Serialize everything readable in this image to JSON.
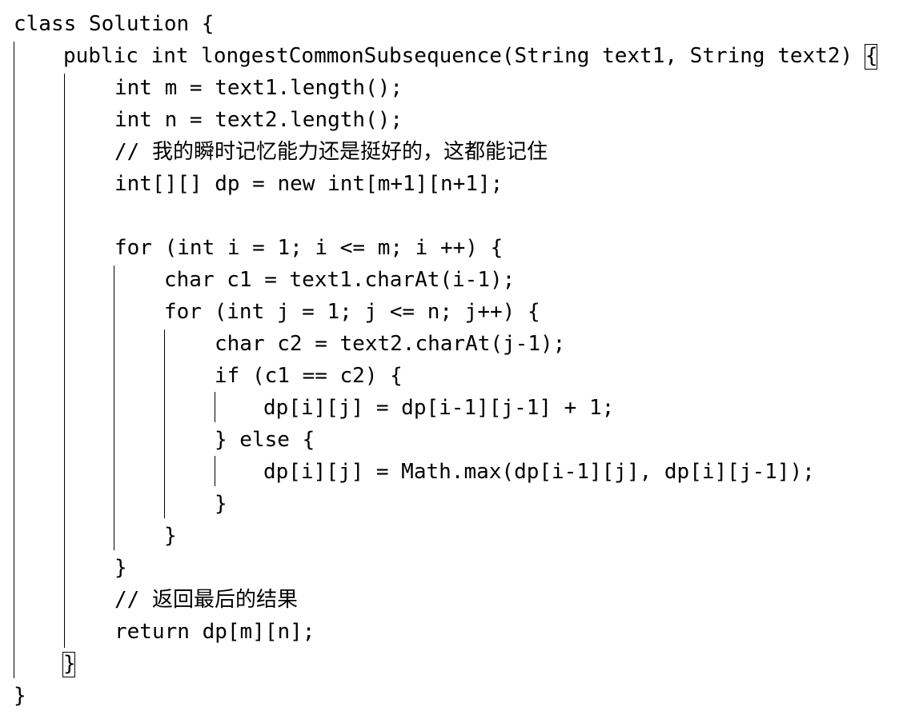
{
  "editor": {
    "lines": [
      "class Solution {",
      "public int longestCommonSubsequence(String text1, String text2) {",
      "int m = text1.length();",
      "int n = text2.length();",
      "// 我的瞬时记忆能力还是挺好的，这都能记住",
      "int[][] dp = new int[m+1][n+1];",
      "",
      "for (int i = 1; i <= m; i ++) {",
      "char c1 = text1.charAt(i-1);",
      "for (int j = 1; j <= n; j++) {",
      "char c2 = text2.charAt(j-1);",
      "if (c1 == c2) {",
      "dp[i][j] = dp[i-1][j-1] + 1;",
      "} else {",
      "dp[i][j] = Math.max(dp[i-1][j], dp[i][j-1]);",
      "}",
      "}",
      "}",
      "// 返回最后的结果",
      "return dp[m][n];",
      "}",
      "}"
    ]
  }
}
